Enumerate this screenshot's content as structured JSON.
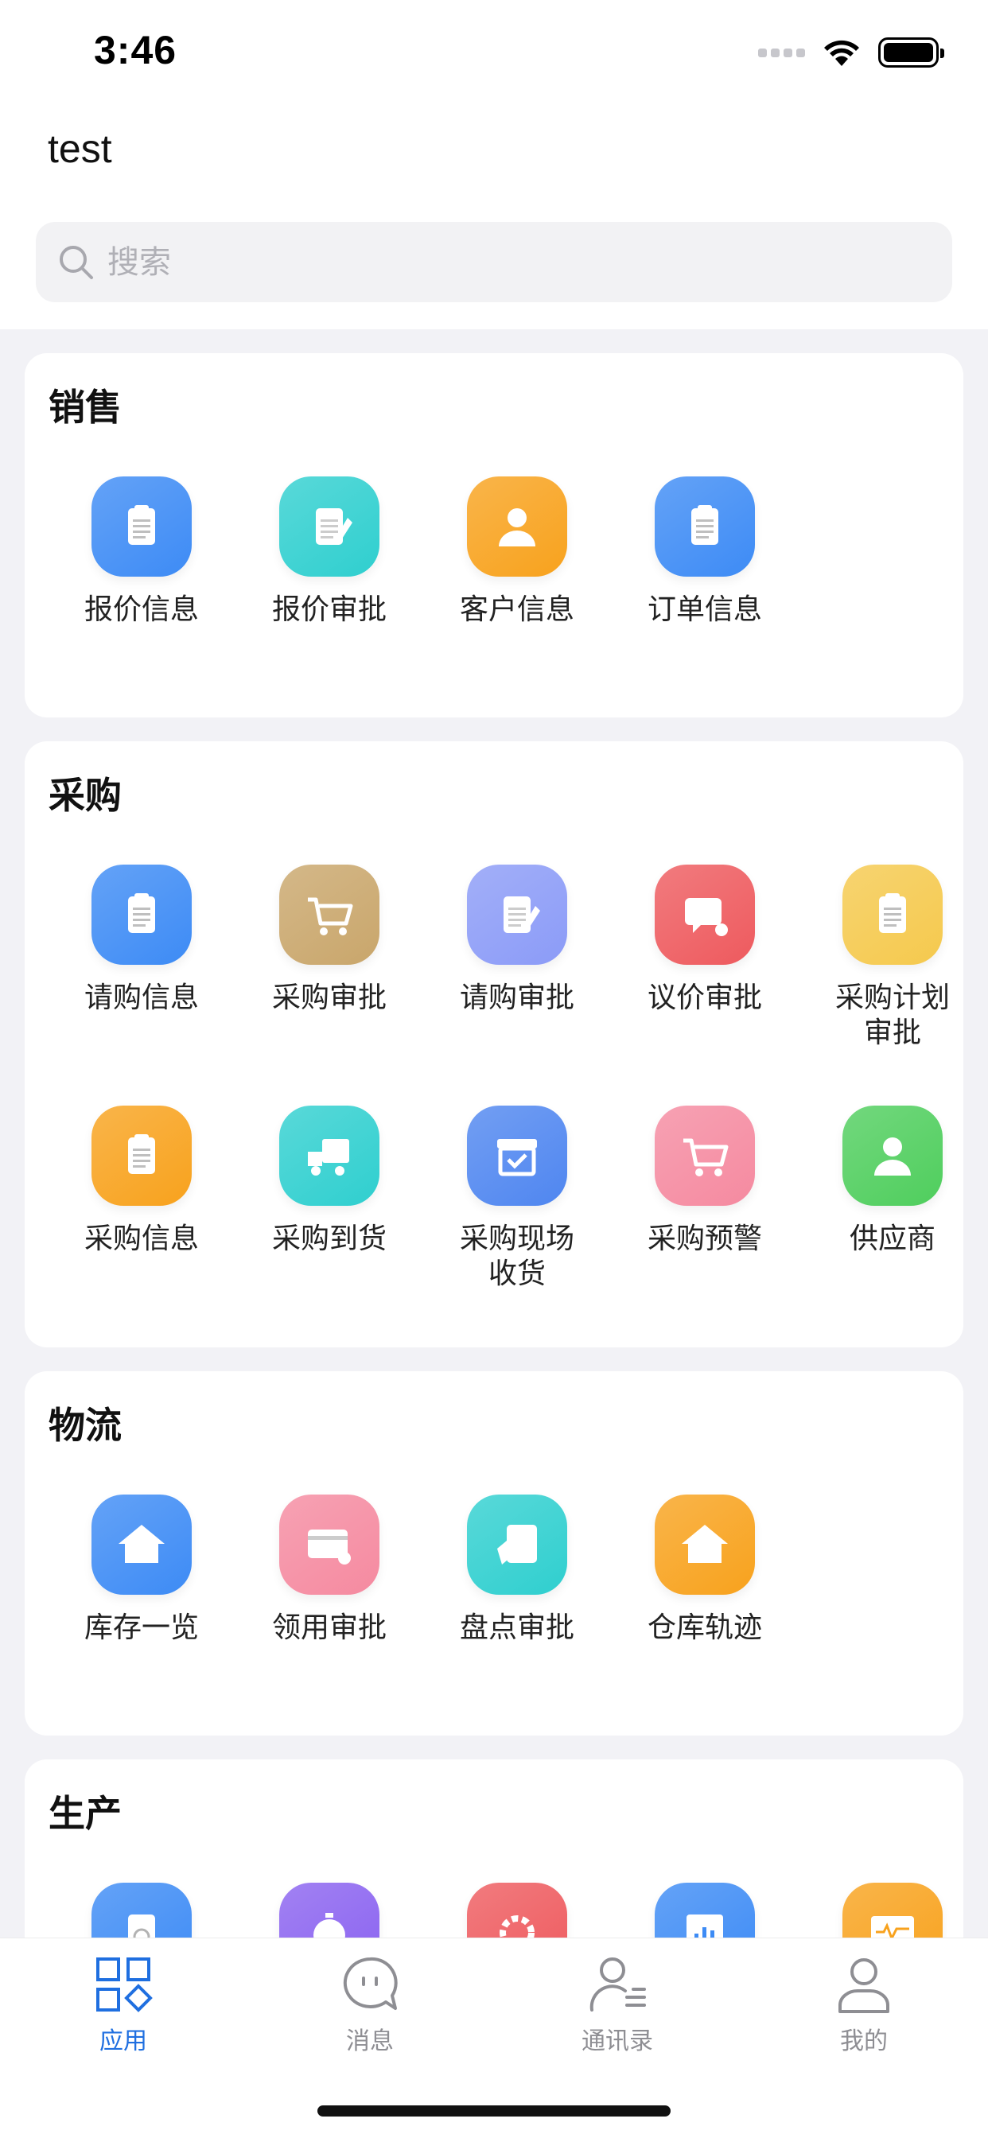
{
  "status": {
    "time": "3:46"
  },
  "user": {
    "name": "test"
  },
  "search": {
    "placeholder": "搜索"
  },
  "sections": {
    "sales": {
      "title": "销售",
      "items": [
        {
          "label": "报价信息",
          "icon": "quote-doc-icon",
          "color": "#3d8bf5"
        },
        {
          "label": "报价审批",
          "icon": "quote-approve-icon",
          "color": "#2fcfcf"
        },
        {
          "label": "客户信息",
          "icon": "customer-icon",
          "color": "#f8a21d"
        },
        {
          "label": "订单信息",
          "icon": "order-doc-icon",
          "color": "#3d8bf5"
        }
      ]
    },
    "purchase": {
      "title": "采购",
      "items": [
        {
          "label": "请购信息",
          "icon": "requisition-doc-icon",
          "color": "#3d8bf5"
        },
        {
          "label": "采购审批",
          "icon": "cart-approve-icon",
          "color": "#c9a66b"
        },
        {
          "label": "请购审批",
          "icon": "requisition-approve-icon",
          "color": "#8b9bf7"
        },
        {
          "label": "议价审批",
          "icon": "bargain-icon",
          "color": "#ee5a5e"
        },
        {
          "label": "采购计划\n审批",
          "icon": "plan-approve-icon",
          "color": "#f5c94d"
        },
        {
          "label": "采购信息",
          "icon": "purchase-info-icon",
          "color": "#f8a21d"
        },
        {
          "label": "采购到货",
          "icon": "truck-icon",
          "color": "#2fcfcf"
        },
        {
          "label": "采购现场\n收货",
          "icon": "box-check-icon",
          "color": "#4f86f0"
        },
        {
          "label": "采购预警",
          "icon": "cart-alert-icon",
          "color": "#f58aa0"
        },
        {
          "label": "供应商",
          "icon": "supplier-icon",
          "color": "#4fce5d"
        }
      ]
    },
    "logistics": {
      "title": "物流",
      "items": [
        {
          "label": "库存一览",
          "icon": "warehouse-icon",
          "color": "#3d8bf5"
        },
        {
          "label": "领用审批",
          "icon": "card-approve-icon",
          "color": "#f58aa0"
        },
        {
          "label": "盘点审批",
          "icon": "inventory-check-icon",
          "color": "#2fcfcf"
        },
        {
          "label": "仓库轨迹",
          "icon": "warehouse-track-icon",
          "color": "#f8a21d"
        }
      ]
    },
    "production": {
      "title": "生产",
      "items": [
        {
          "icon": "schedule-icon",
          "color": "#3d8bf5"
        },
        {
          "icon": "timer-icon",
          "color": "#8a62f0"
        },
        {
          "icon": "gear-icon",
          "color": "#ee5a5e"
        },
        {
          "icon": "chart-icon",
          "color": "#3d8bf5"
        },
        {
          "icon": "monitor-icon",
          "color": "#f8a21d"
        }
      ]
    }
  },
  "tabs": [
    {
      "label": "应用",
      "icon": "apps-icon",
      "active": true
    },
    {
      "label": "消息",
      "icon": "chat-icon",
      "active": false
    },
    {
      "label": "通讯录",
      "icon": "contacts-icon",
      "active": false
    },
    {
      "label": "我的",
      "icon": "profile-icon",
      "active": false
    }
  ],
  "colors": {
    "accent": "#1f6fe0",
    "inactive": "#8e8e93"
  }
}
